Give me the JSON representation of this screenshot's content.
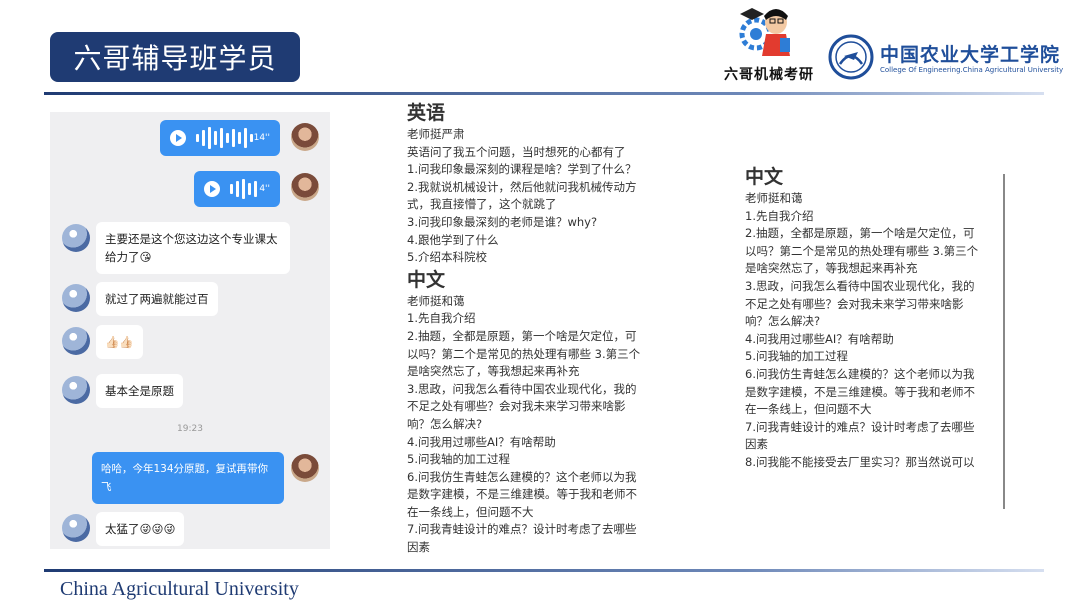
{
  "header": {
    "title": "六哥辅导班学员",
    "mascot_caption": "六哥机械考研",
    "university_cn": "中国农业大学工学院",
    "university_en": "College Of Engineering.China Agricultural University"
  },
  "footer": {
    "text": "China Agricultural University"
  },
  "chat": {
    "voice_messages": [
      {
        "duration": "14''"
      },
      {
        "duration": "4''"
      }
    ],
    "messages": [
      {
        "text": "主要还是这个您这边这个专业课太给力了😘"
      },
      {
        "text": "就过了两遍就能过百"
      },
      {
        "text": "👍🏻👍🏻"
      },
      {
        "text": "基本全是原题"
      }
    ],
    "timestamp": "19:23",
    "my_message": "哈哈，今年134分原题，复试再带你飞",
    "last_message": "太猛了😜😜😜"
  },
  "middle": {
    "english_heading": "英语",
    "english_lines": [
      "老师挺严肃",
      "英语问了我五个问题，当时想死的心都有了",
      "1.问我印象最深刻的课程是啥？学到了什么？",
      "2.我就说机械设计，然后他就问我机械传动方式，我直接懵了，这个就跳了",
      "3.问我印象最深刻的老师是谁？why?",
      "4.跟他学到了什么",
      "5.介绍本科院校"
    ],
    "chinese_heading": "中文",
    "chinese_lines": [
      "老师挺和蔼",
      "1.先自我介绍",
      "2.抽题，全都是原题，第一个啥是欠定位，可以吗？第二个是常见的热处理有哪些 3.第三个是啥突然忘了，等我想起来再补充",
      "3.思政，问我怎么看待中国农业现代化，我的不足之处有哪些？会对我未来学习带来啥影响？怎么解决?",
      "4.问我用过哪些AI？有啥帮助",
      "5.问我轴的加工过程",
      "6.问我仿生青蛙怎么建模的？这个老师以为我是数字建模，不是三维建模。等于我和老师不在一条线上，但问题不大",
      "7.问我青蛙设计的难点？设计时考虑了去哪些因素"
    ]
  },
  "right": {
    "heading": "中文",
    "lines": [
      "老师挺和蔼",
      "1.先自我介绍",
      "2.抽题，全都是原题，第一个啥是欠定位，可以吗？第二个是常见的热处理有哪些 3.第三个是啥突然忘了，等我想起来再补充",
      "3.思政，问我怎么看待中国农业现代化，我的不足之处有哪些？会对我未来学习带来啥影响？怎么解决?",
      "4.问我用过哪些AI？有啥帮助",
      "5.问我轴的加工过程",
      "6.问我仿生青蛙怎么建模的？这个老师以为我是数字建模，不是三维建模。等于我和老师不在一条线上，但问题不大",
      "7.问我青蛙设计的难点？设计时考虑了去哪些因素",
      "8.问我能不能接受去厂里实习？那当然说可以"
    ]
  }
}
